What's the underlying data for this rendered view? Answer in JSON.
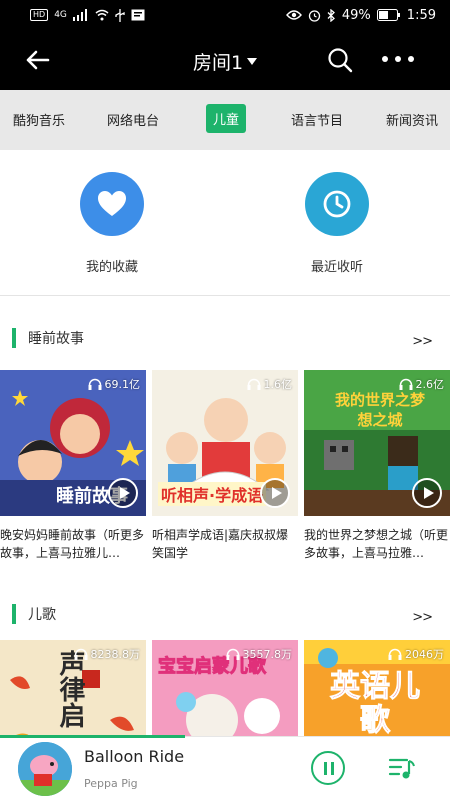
{
  "status": {
    "left": [
      "HD",
      "4G"
    ],
    "battery": "49%",
    "time": "1:59"
  },
  "header": {
    "title": "房间1"
  },
  "tabs": [
    "酷狗音乐",
    "网络电台",
    "儿童",
    "语言节目",
    "新闻资讯"
  ],
  "quick": {
    "favorites": "我的收藏",
    "recent": "最近收听"
  },
  "sections": [
    {
      "title": "睡前故事",
      "more": ">>",
      "cards": [
        {
          "plays": "69.1亿",
          "title": "晚安妈妈睡前故事（听更多故事，上喜马拉雅儿…",
          "thumb_text": "睡前故事"
        },
        {
          "plays": "1.6亿",
          "title": "听相声学成语|嘉庆叔叔爆笑国学",
          "thumb_text": "听相声·学成语"
        },
        {
          "plays": "2.6亿",
          "title": "我的世界之梦想之城（听更多故事，上喜马拉雅…",
          "thumb_text": "我的世界之梦想之城"
        }
      ]
    },
    {
      "title": "儿歌",
      "more": ">>",
      "cards": [
        {
          "plays": "8238.8万",
          "title": "",
          "thumb_text": "声律启"
        },
        {
          "plays": "3557.8万",
          "title": "",
          "thumb_text": "宝宝启蒙儿歌"
        },
        {
          "plays": "2046万",
          "title": "",
          "thumb_text": "英语儿歌"
        }
      ]
    }
  ],
  "player": {
    "title": "Balloon Ride",
    "artist": "Peppa Pig",
    "progress": 0.41
  },
  "colors": {
    "accent": "#1db36b",
    "favorite": "#3d8ee8",
    "recent": "#2aa6d5"
  }
}
